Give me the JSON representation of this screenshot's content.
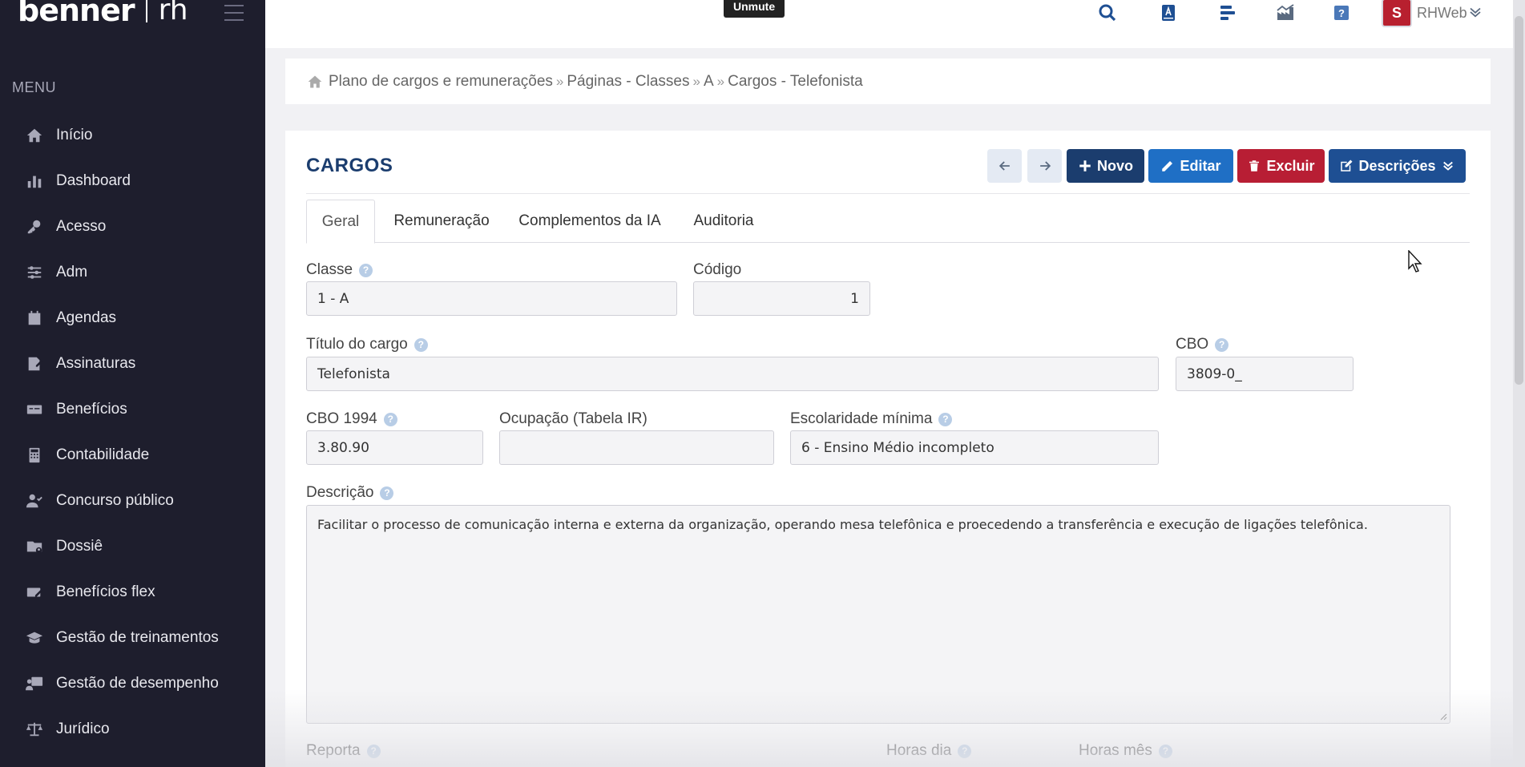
{
  "brand": {
    "logo": "benner",
    "product": "rh"
  },
  "menu": {
    "heading": "MENU",
    "items": [
      {
        "label": "Início",
        "icon": "home-icon"
      },
      {
        "label": "Dashboard",
        "icon": "bar-chart-icon"
      },
      {
        "label": "Acesso",
        "icon": "key-icon"
      },
      {
        "label": "Adm",
        "icon": "sliders-icon"
      },
      {
        "label": "Agendas",
        "icon": "calendar-icon"
      },
      {
        "label": "Assinaturas",
        "icon": "signature-icon"
      },
      {
        "label": "Benefícios",
        "icon": "money-icon"
      },
      {
        "label": "Contabilidade",
        "icon": "calculator-icon"
      },
      {
        "label": "Concurso público",
        "icon": "user-check-icon"
      },
      {
        "label": "Dossiê",
        "icon": "folder-user-icon"
      },
      {
        "label": "Benefícios flex",
        "icon": "card-flex-icon"
      },
      {
        "label": "Gestão de treinamentos",
        "icon": "graduation-cap-icon"
      },
      {
        "label": "Gestão de desempenho",
        "icon": "presentation-icon"
      },
      {
        "label": "Jurídico",
        "icon": "scale-icon"
      }
    ]
  },
  "topbar": {
    "unmute_label": "Unmute",
    "avatar_letter": "S",
    "user_name": "RHWeb"
  },
  "breadcrumb": {
    "items": [
      "Plano de cargos e remunerações",
      "Páginas - Classes",
      "A",
      "Cargos - Telefonista"
    ]
  },
  "page": {
    "title": "CARGOS",
    "buttons": {
      "novo": "Novo",
      "editar": "Editar",
      "excluir": "Excluir",
      "descricoes": "Descrições"
    },
    "tabs": [
      "Geral",
      "Remuneração",
      "Complementos da IA",
      "Auditoria"
    ],
    "active_tab": "Geral"
  },
  "form": {
    "classe": {
      "label": "Classe",
      "value": "1 - A"
    },
    "codigo": {
      "label": "Código",
      "value": "1"
    },
    "titulo": {
      "label": "Título do cargo",
      "value": "Telefonista"
    },
    "cbo": {
      "label": "CBO",
      "value": "3809-0_"
    },
    "cbo1994": {
      "label": "CBO 1994",
      "value": "3.80.90"
    },
    "ocupacao": {
      "label": "Ocupação (Tabela IR)",
      "value": ""
    },
    "escolaridade": {
      "label": "Escolaridade mínima",
      "value": "6 - Ensino Médio incompleto"
    },
    "descricao": {
      "label": "Descrição",
      "value": "Facilitar o processo de comunicação interna e externa da organização, operando mesa telefônica e proecedendo a transferência e execução de ligações telefônica."
    },
    "reporta": {
      "label": "Reporta"
    },
    "horas_dia": {
      "label": "Horas dia"
    },
    "horas_mes": {
      "label": "Horas mês"
    }
  },
  "colors": {
    "sidebar_bg": "#1e1e2d",
    "title": "#1b3d6e",
    "novo": "#1b3d6e",
    "editar": "#1f6fc5",
    "excluir": "#b81e34",
    "descricoes": "#1e4f93"
  }
}
